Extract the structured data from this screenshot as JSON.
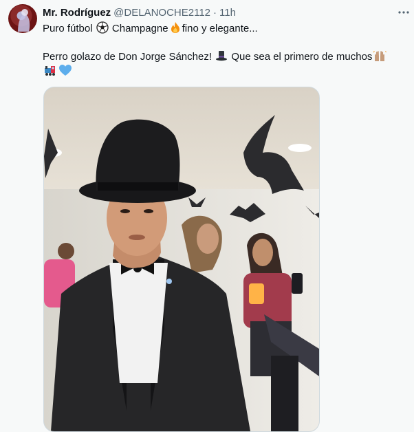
{
  "tweet": {
    "author_name": "Mr. Rodríguez",
    "handle": "@DELANOCHE2112",
    "separator": "·",
    "time": "11h",
    "line1": {
      "a": "Puro fútbol",
      "b": "Champagne",
      "c": "fino y elegante..."
    },
    "line2": {
      "a": "Perro golazo de Don Jorge Sánchez!",
      "b": "Que sea el primero de muchos"
    },
    "icons": [
      "soccer-ball-icon",
      "fire-icon",
      "top-hat-icon",
      "raising-hands-icon",
      "locomotive-icon",
      "blue-heart-icon",
      "more-icon"
    ],
    "colors": {
      "text": "#0f1419",
      "secondary": "#536471",
      "background": "#f7f9f9",
      "blue_heart": "#5cadec",
      "fire": "#f4900c"
    }
  }
}
